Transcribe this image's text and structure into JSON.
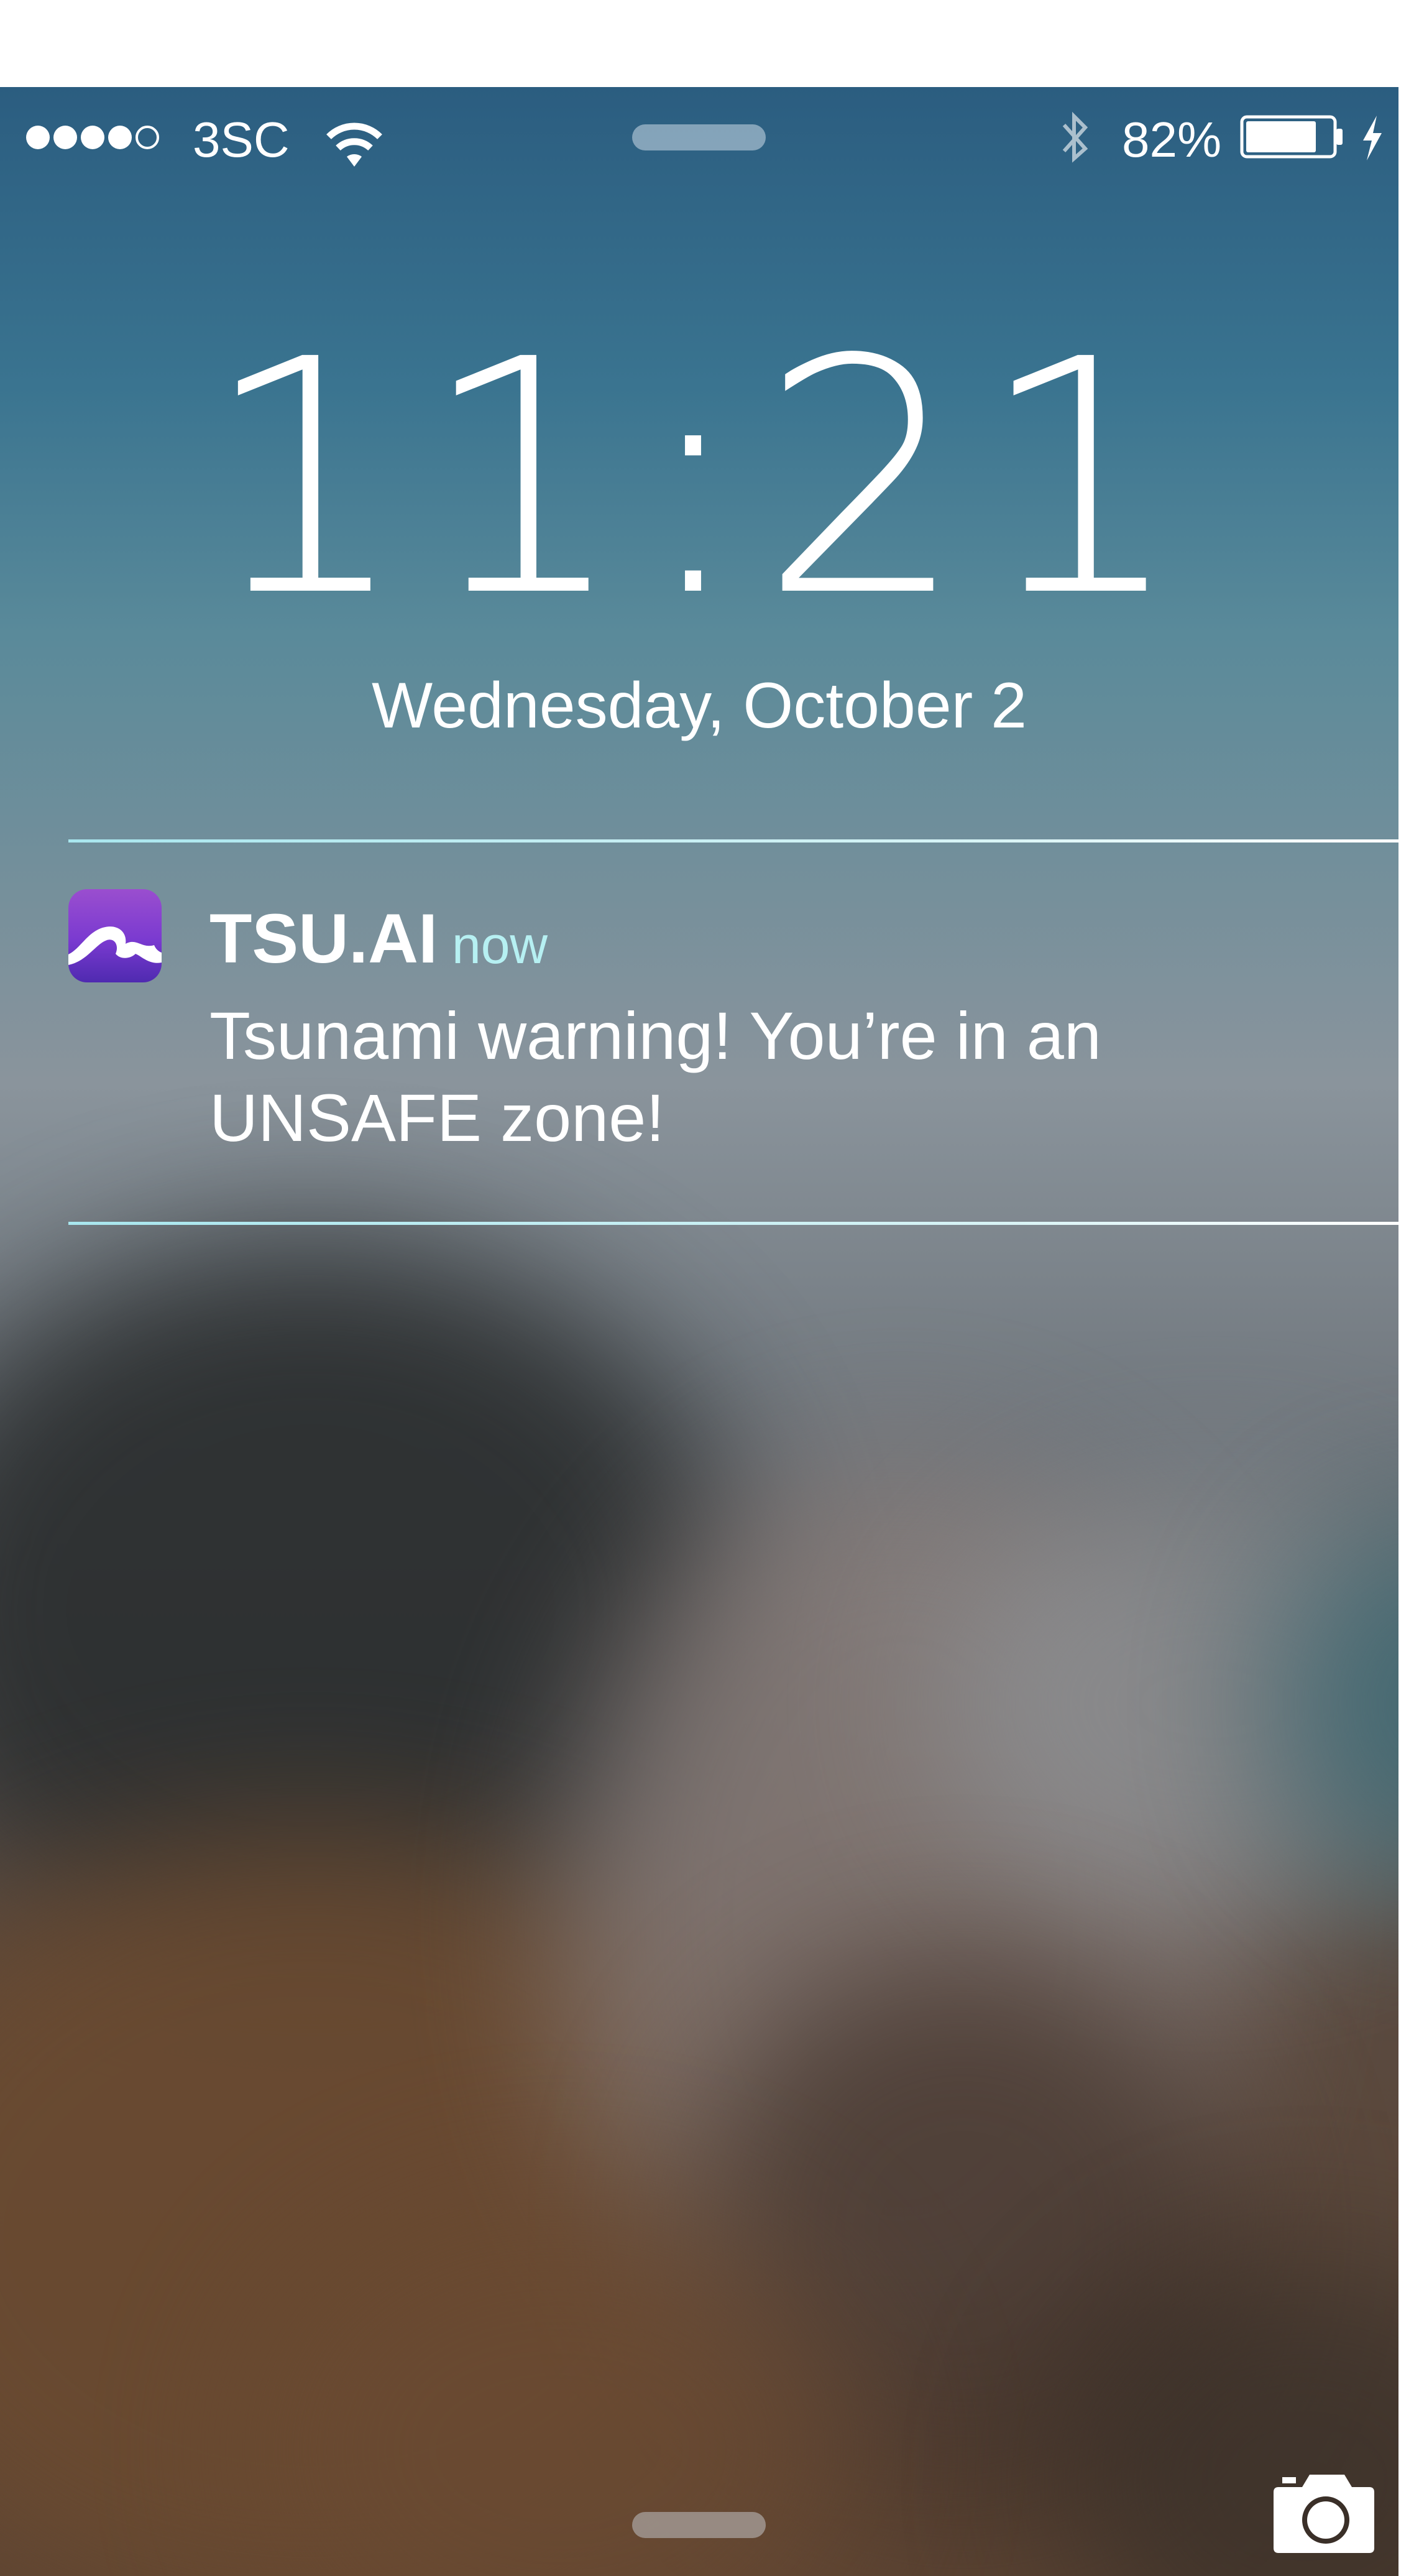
{
  "status_bar": {
    "signal_bars_filled": 4,
    "signal_bars_total": 5,
    "carrier": "3SC",
    "battery_percent": "82%",
    "battery_level": 0.82,
    "charging": true,
    "icons": [
      "signal-dots-icon",
      "wifi-icon",
      "bluetooth-icon",
      "battery-icon",
      "charging-bolt-icon"
    ]
  },
  "lock_screen": {
    "time": "11:21",
    "date": "Wednesday, October 2"
  },
  "notification": {
    "app_name": "TSU.AI",
    "time_ago": "now",
    "message": "Tsunami warning! You’re in an UNSAFE zone!",
    "icon": "wave-icon",
    "icon_colors": [
      "#9a4ecf",
      "#4f2ab0"
    ]
  },
  "bottom": {
    "icons": [
      "camera-icon"
    ]
  },
  "colors": {
    "notification_divider": "#a8e6ee",
    "time_ago_text": "#b6f0f2"
  }
}
